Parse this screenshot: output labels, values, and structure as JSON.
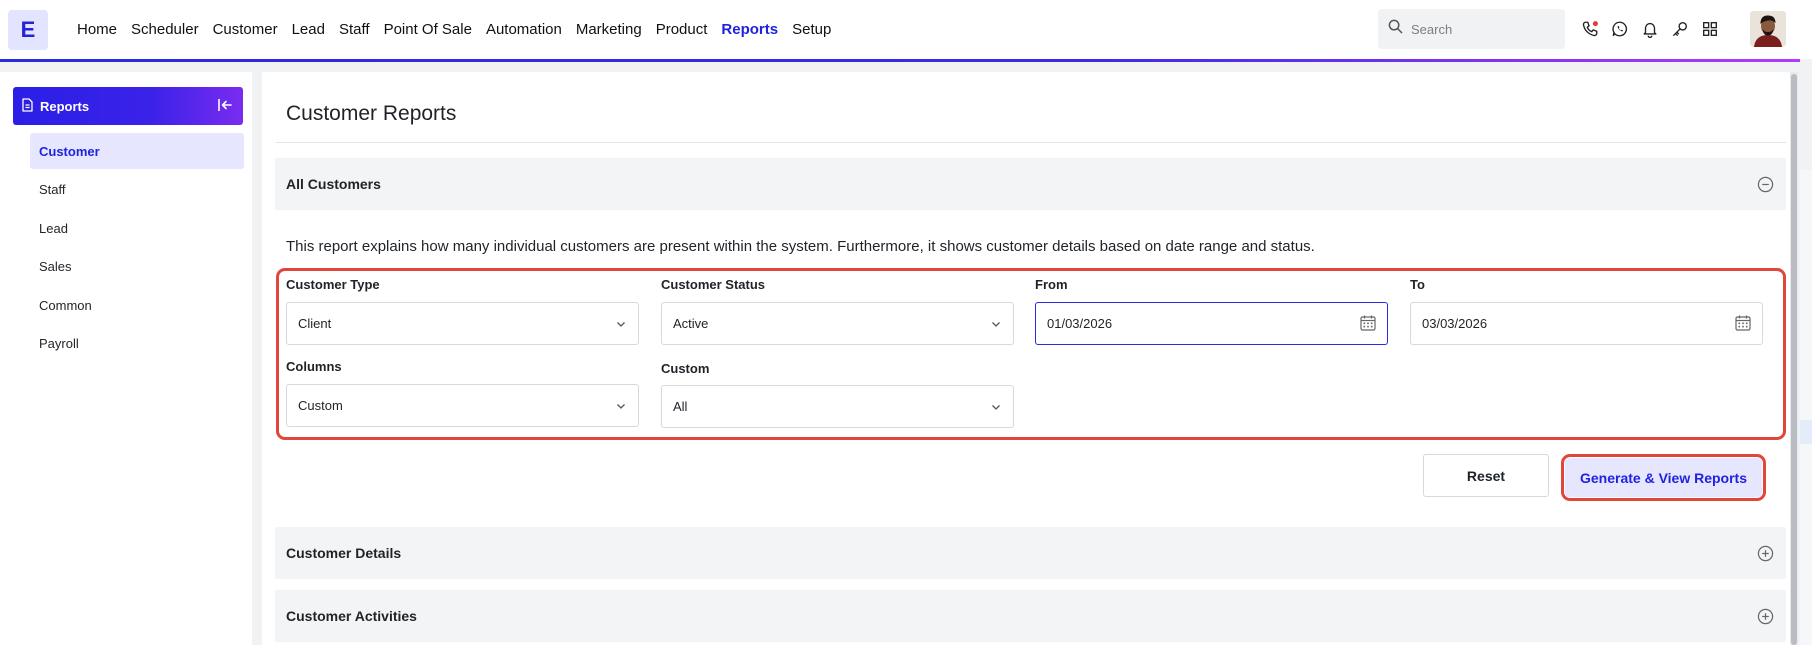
{
  "app": {
    "logo_letter": "E",
    "accent": "#1f23e0",
    "highlight_border": "#e0463a"
  },
  "nav": {
    "items": [
      "Home",
      "Scheduler",
      "Customer",
      "Lead",
      "Staff",
      "Point Of Sale",
      "Automation",
      "Marketing",
      "Product",
      "Reports",
      "Setup"
    ],
    "active": "Reports"
  },
  "search": {
    "placeholder": "Search",
    "icon": "search-icon"
  },
  "top_icons": [
    "phone-icon",
    "whatsapp-icon",
    "bell-icon",
    "key-icon",
    "apps-grid-icon"
  ],
  "sidebar": {
    "title": "Reports",
    "items": [
      {
        "label": "Customer",
        "active": true
      },
      {
        "label": "Staff"
      },
      {
        "label": "Lead"
      },
      {
        "label": "Sales"
      },
      {
        "label": "Common"
      },
      {
        "label": "Payroll"
      }
    ]
  },
  "main": {
    "title": "Customer Reports",
    "sections": {
      "all_customers": "All Customers",
      "customer_details": "Customer Details",
      "customer_activities": "Customer Activities"
    },
    "description": "This report explains how many individual customers are present within the system. Furthermore, it shows customer details based on date range and status.",
    "filters": {
      "customer_type": {
        "label": "Customer Type",
        "value": "Client"
      },
      "customer_status": {
        "label": "Customer Status",
        "value": "Active"
      },
      "from": {
        "label": "From",
        "value": "01/03/2026"
      },
      "to": {
        "label": "To",
        "value": "03/03/2026"
      },
      "columns": {
        "label": "Columns",
        "value": "Custom"
      },
      "custom": {
        "label": "Custom",
        "value": "All"
      }
    },
    "buttons": {
      "reset": "Reset",
      "generate": "Generate & View Reports"
    }
  }
}
